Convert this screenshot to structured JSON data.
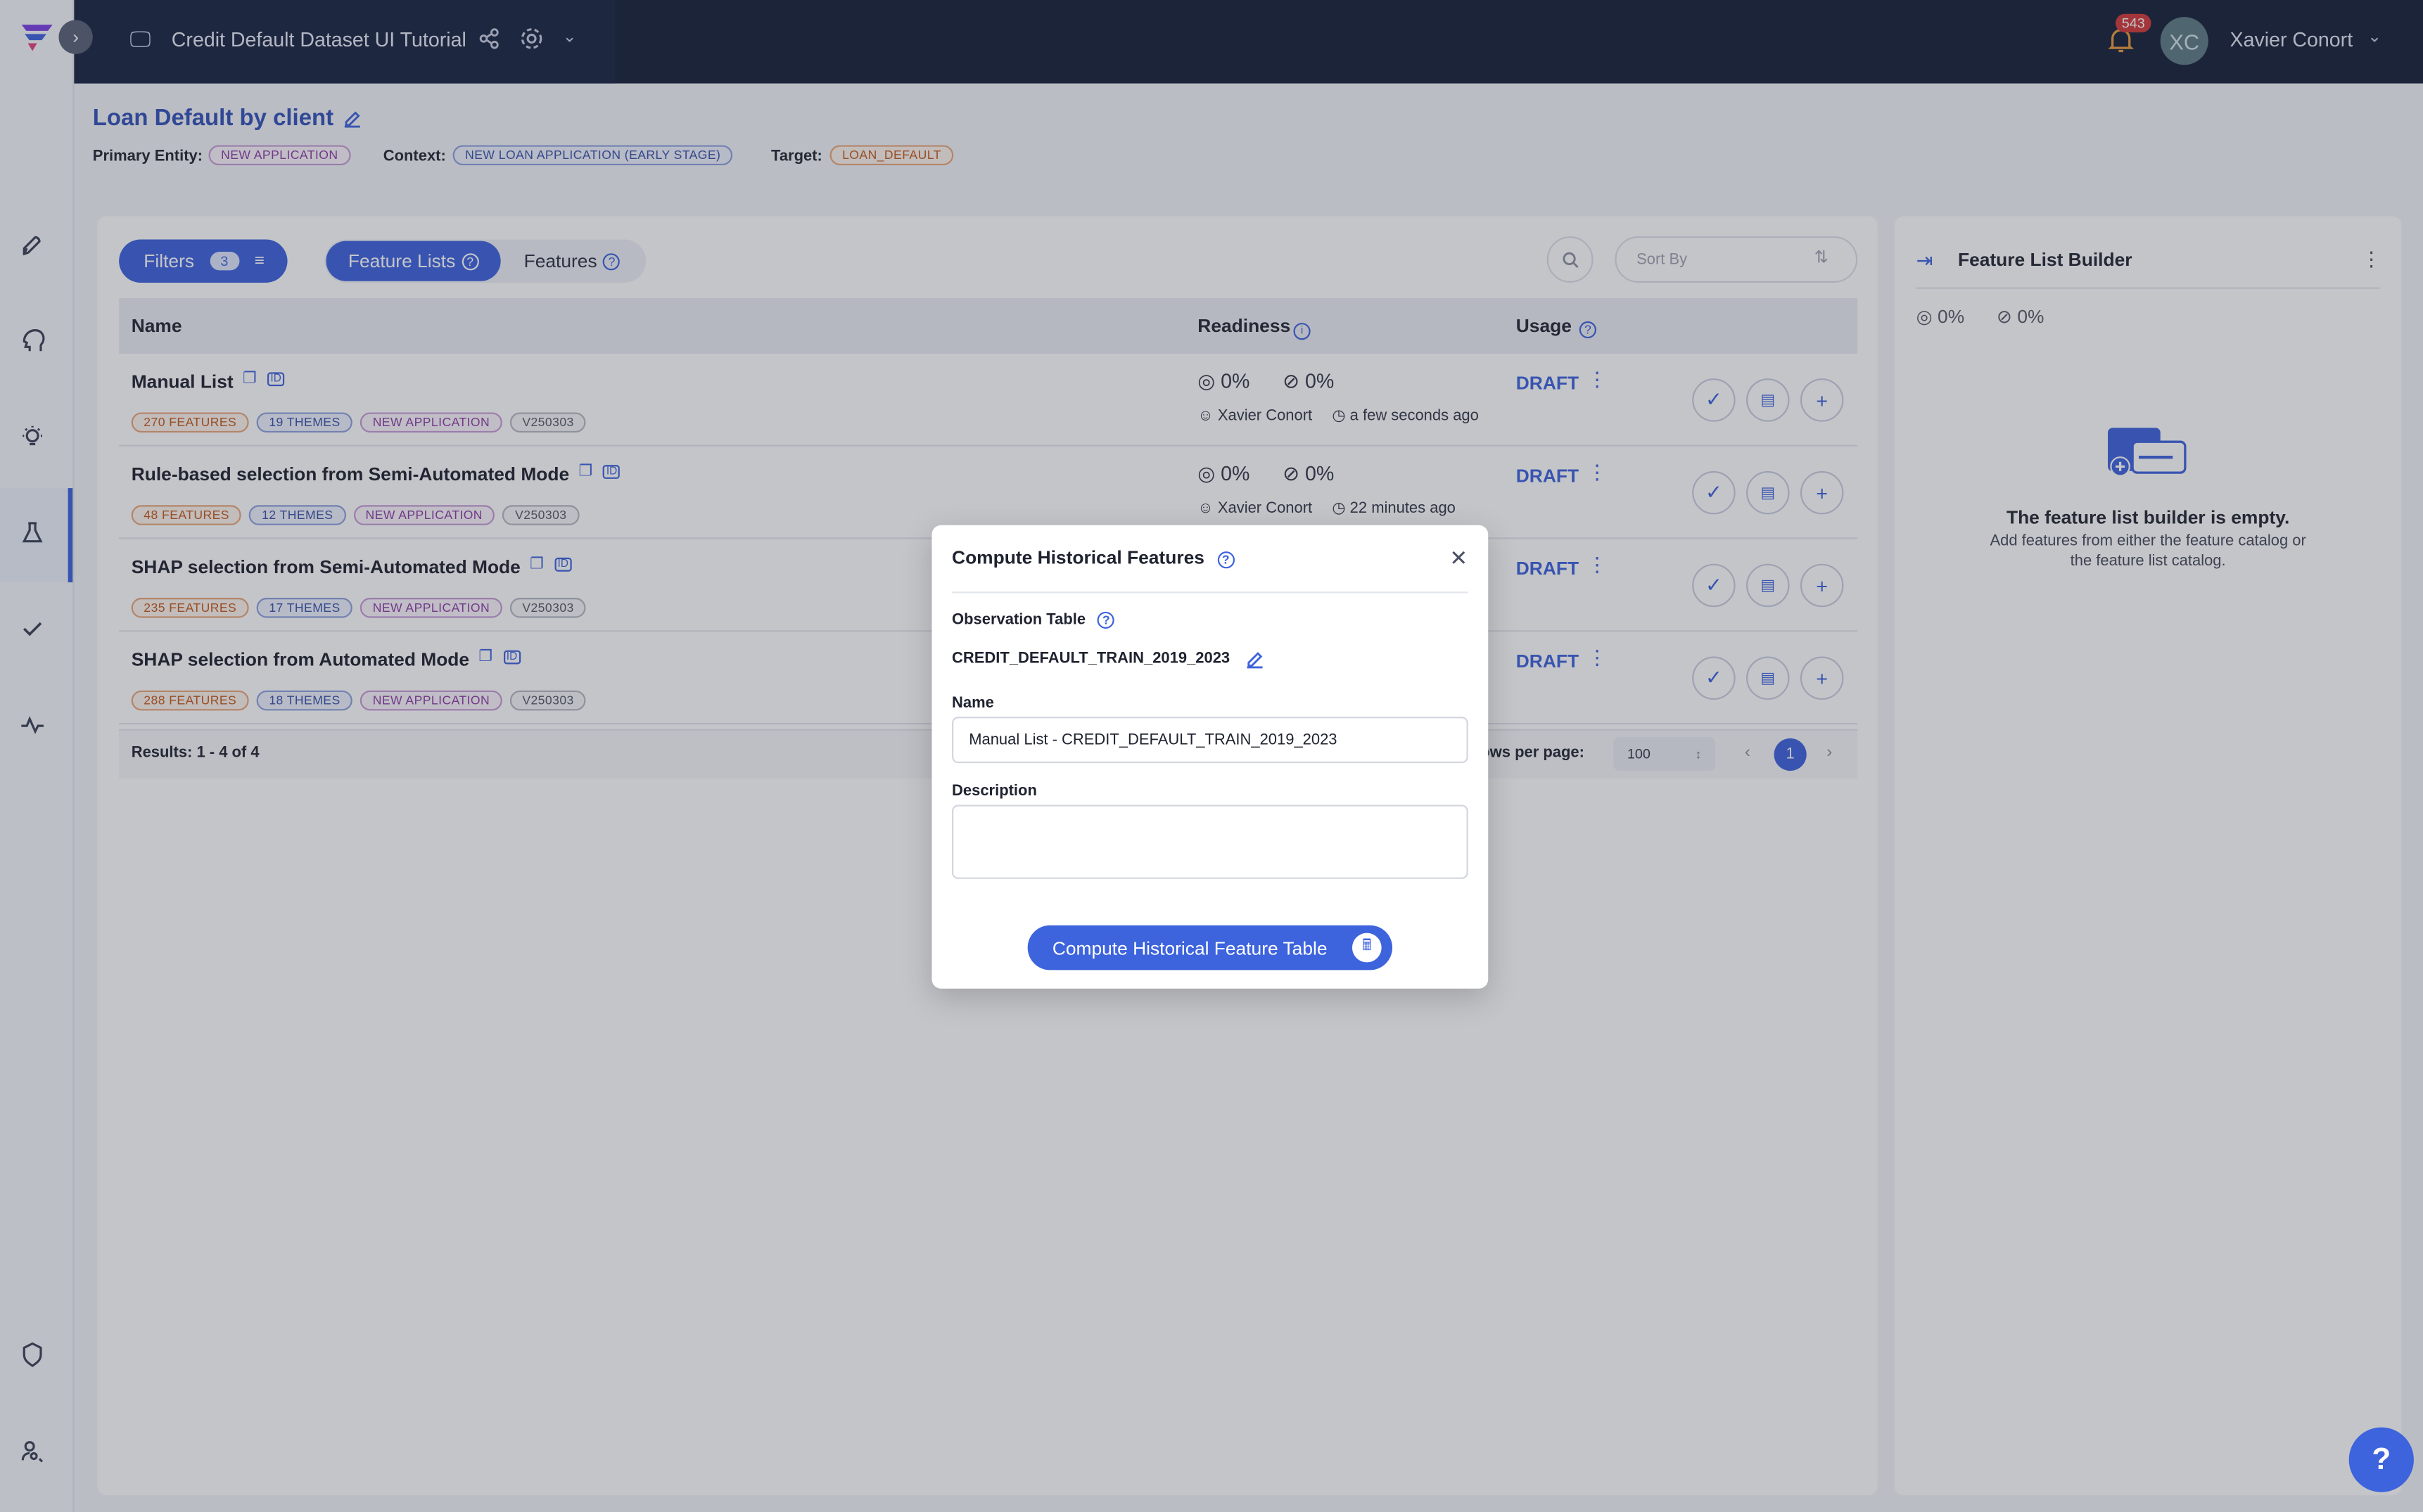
{
  "header": {
    "project_title": "Credit Default Dataset UI Tutorial",
    "notification_count": "543",
    "avatar_initials": "XC",
    "user_name": "Xavier Conort"
  },
  "catalog": {
    "title": "Loan Default by client",
    "primary_entity_label": "Primary Entity:",
    "primary_entity": "NEW APPLICATION",
    "context_label": "Context:",
    "context": "NEW LOAN APPLICATION (EARLY STAGE)",
    "target_label": "Target:",
    "target": "LOAN_DEFAULT"
  },
  "toolbar": {
    "filters_label": "Filters",
    "filters_count": "3",
    "tab_feature_lists": "Feature Lists",
    "tab_features": "Features",
    "sort_placeholder": "Sort By"
  },
  "table": {
    "col_name": "Name",
    "col_readiness": "Readiness",
    "col_usage": "Usage",
    "rows": [
      {
        "name": "Manual List",
        "features": "270 FEATURES",
        "themes": "19 THEMES",
        "entity": "NEW APPLICATION",
        "version": "V250303",
        "ready": "0%",
        "online": "0%",
        "owner": "Xavier Conort",
        "time": "a few seconds ago",
        "status": "DRAFT"
      },
      {
        "name": "Rule-based selection from Semi-Automated Mode",
        "features": "48 FEATURES",
        "themes": "12 THEMES",
        "entity": "NEW APPLICATION",
        "version": "V250303",
        "ready": "0%",
        "online": "0%",
        "owner": "Xavier Conort",
        "time": "22 minutes ago",
        "status": "DRAFT"
      },
      {
        "name": "SHAP selection from Semi-Automated Mode",
        "features": "235 FEATURES",
        "themes": "17 THEMES",
        "entity": "NEW APPLICATION",
        "version": "V250303",
        "status": "DRAFT"
      },
      {
        "name": "SHAP selection from Automated Mode",
        "features": "288 FEATURES",
        "themes": "18 THEMES",
        "entity": "NEW APPLICATION",
        "version": "V250303",
        "status": "DRAFT"
      }
    ],
    "results": "Results: 1 - 4 of 4",
    "rows_per_page_label": "ows per page:",
    "rows_per_page": "100",
    "current_page": "1"
  },
  "builder": {
    "title": "Feature List Builder",
    "ready": "0%",
    "online": "0%",
    "empty_title": "The feature list builder is empty.",
    "empty_text": "Add features from either the feature catalog or the feature list catalog."
  },
  "modal": {
    "title": "Compute Historical Features",
    "observation_label": "Observation Table",
    "observation_value": "CREDIT_DEFAULT_TRAIN_2019_2023",
    "name_label": "Name",
    "name_value": "Manual List - CREDIT_DEFAULT_TRAIN_2019_2023",
    "description_label": "Description",
    "description_value": "",
    "submit_label": "Compute Historical Feature Table"
  },
  "help_label": "?",
  "colors": {
    "accent": "#3d63dd",
    "header_bg": "#17203a",
    "draft": "#3d63dd"
  }
}
